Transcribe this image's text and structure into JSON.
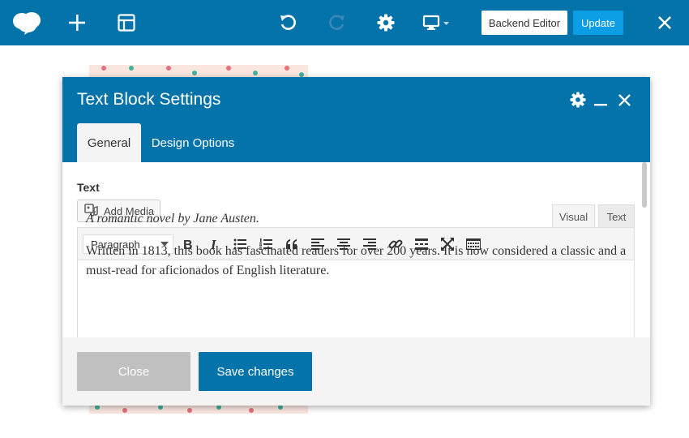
{
  "topbar": {
    "backend_editor_label": "Backend Editor",
    "update_label": "Update",
    "icons": [
      "logo-cloud-icon",
      "add-element-icon",
      "templates-icon",
      "undo-icon",
      "redo-icon",
      "settings-icon",
      "responsive-preview-icon",
      "close-icon"
    ]
  },
  "modal": {
    "title": "Text Block Settings",
    "tabs": [
      {
        "label": "General",
        "active": true
      },
      {
        "label": "Design Options",
        "active": false
      }
    ],
    "field_label": "Text",
    "add_media_label": "Add Media",
    "mode_tabs": {
      "visual": "Visual",
      "text": "Text"
    },
    "format_select": "Paragraph",
    "toolbar_tools": [
      "bold-icon",
      "italic-icon",
      "bullet-list-icon",
      "numbered-list-icon",
      "blockquote-icon",
      "align-left-icon",
      "align-center-icon",
      "align-right-icon",
      "link-icon",
      "read-more-icon",
      "fullscreen-icon",
      "toolbar-toggle-icon"
    ],
    "content": {
      "paragraph1": "A romantic novel by Jane Austen.",
      "paragraph2": "Written in 1813, this book has fascinated readers for over 200 years. It is now considered a classic and a must-read for aficionados of English literature."
    },
    "footer": {
      "close_label": "Close",
      "save_label": "Save changes"
    }
  },
  "colors": {
    "primary": "#0473aa",
    "accent": "#0c9ee5",
    "close_button": "#c0c0c0"
  }
}
